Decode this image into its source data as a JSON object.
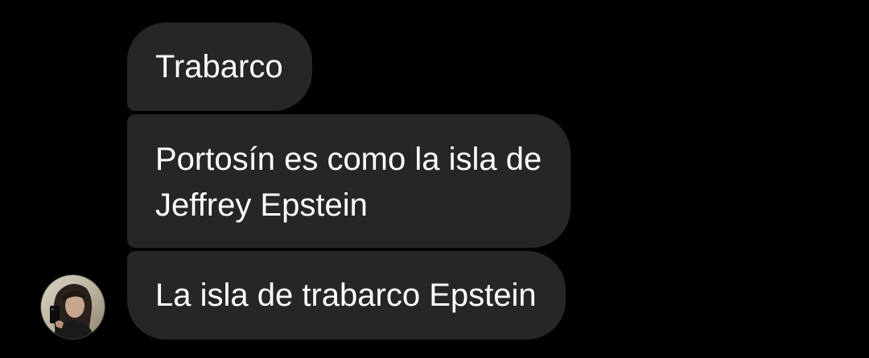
{
  "conversation": {
    "messages": [
      {
        "lines": [
          "Trabarco"
        ]
      },
      {
        "lines": [
          "Portosín es como la isla de",
          "Jeffrey Epstein"
        ]
      },
      {
        "lines": [
          "La isla de trabarco Epstein"
        ]
      }
    ],
    "sender": {
      "avatar_icon": "profile-photo-avatar"
    }
  },
  "colors": {
    "background": "#000000",
    "bubble": "#262626",
    "text": "#ffffff"
  }
}
